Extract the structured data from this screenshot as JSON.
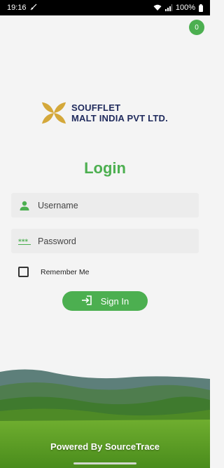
{
  "status_bar": {
    "time": "19:16",
    "battery": "100%"
  },
  "notification": {
    "count": "0"
  },
  "brand": {
    "line1": "SOUFFLET",
    "line2": "MALT INDIA PVT LTD."
  },
  "login": {
    "title": "Login",
    "username_placeholder": "Username",
    "password_placeholder": "Password",
    "remember_label": "Remember Me",
    "signin_label": "Sign In"
  },
  "footer": {
    "powered_by": "Powered By SourceTrace"
  },
  "colors": {
    "accent_green": "#4caf50",
    "brand_navy": "#1f2a5c",
    "brand_gold": "#d4a83a"
  },
  "icons": {
    "status": [
      "mute-icon",
      "wifi-icon",
      "signal-icon",
      "battery-icon"
    ],
    "username": "person-icon",
    "password": "asterisks-icon",
    "signin": "login-arrow-icon"
  }
}
